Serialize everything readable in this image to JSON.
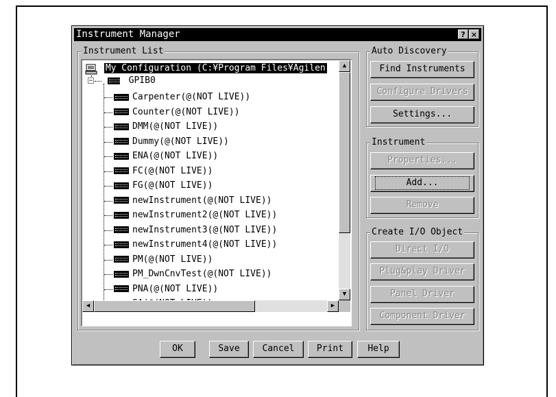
{
  "dialog": {
    "title": "Instrument Manager",
    "help_glyph": "?",
    "close_glyph": "×"
  },
  "instrument_list": {
    "label": "Instrument List",
    "root": "My Configuration (C:¥Program Files¥Agilen",
    "interface": "GPIB0",
    "items": [
      "Carpenter(@(NOT LIVE))",
      "Counter(@(NOT LIVE))",
      "DMM(@(NOT LIVE))",
      "Dummy(@(NOT LIVE))",
      "ENA(@(NOT LIVE))",
      "FC(@(NOT LIVE))",
      "FG(@(NOT LIVE))",
      "newInstrument(@(NOT LIVE))",
      "newInstrument2(@(NOT LIVE))",
      "newInstrument3(@(NOT LIVE))",
      "newInstrument4(@(NOT LIVE))",
      "PM(@(NOT LIVE))",
      "PM_DwnCnvTest(@(NOT LIVE))",
      "PNA(@(NOT LIVE))",
      "SA(@(NOT LIVE))"
    ]
  },
  "auto_discovery": {
    "label": "Auto Discovery",
    "find": "Find Instruments",
    "configure": "Configure Drivers",
    "settings": "Settings..."
  },
  "instrument": {
    "label": "Instrument",
    "properties": "Properties...",
    "add": "Add...",
    "remove": "Remove"
  },
  "create_io": {
    "label": "Create I/O Object",
    "direct": "Direct I/O",
    "plugplay": "Plug&play Driver",
    "panel": "Panel Driver",
    "component": "Component Driver"
  },
  "footer": {
    "ok": "OK",
    "save": "Save",
    "cancel": "Cancel",
    "print": "Print",
    "help": "Help"
  }
}
